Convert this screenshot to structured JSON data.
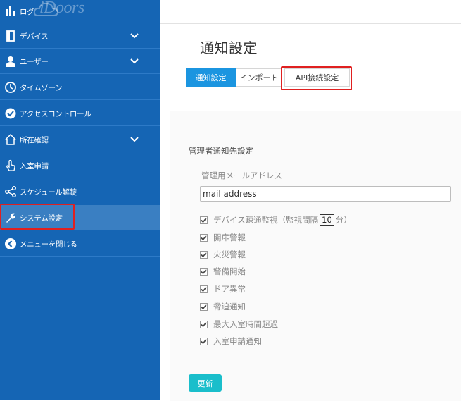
{
  "app": {
    "logo_text": "iDoors"
  },
  "sidebar": {
    "items": [
      {
        "label": "ログ",
        "icon": "bar-chart-icon"
      },
      {
        "label": "デバイス",
        "icon": "device-icon",
        "expandable": true
      },
      {
        "label": "ユーザー",
        "icon": "user-icon",
        "expandable": true
      },
      {
        "label": "タイムゾーン",
        "icon": "clock-icon"
      },
      {
        "label": "アクセスコントロール",
        "icon": "check-circle-icon"
      },
      {
        "label": "所在確認",
        "icon": "home-icon",
        "expandable": true
      },
      {
        "label": "入室申請",
        "icon": "hand-pointer-icon"
      },
      {
        "label": "スケジュール解錠",
        "icon": "share-icon"
      },
      {
        "label": "システム設定",
        "icon": "wrench-icon",
        "active": true
      },
      {
        "label": "メニューを閉じる",
        "icon": "chevron-left-circle-icon"
      }
    ]
  },
  "main": {
    "title": "通知設定",
    "tabs": [
      {
        "label": "通知設定",
        "active": true
      },
      {
        "label": "インポート",
        "active": false
      },
      {
        "label": "API接続設定",
        "active": false
      }
    ],
    "section_title": "管理者通知先設定",
    "email_label": "管理用メールアドレス",
    "email_placeholder": "mail address",
    "checkboxes": [
      {
        "label_before": "デバイス疎通監視（監視間隔",
        "value": "10",
        "label_after": "分）",
        "checked": true
      },
      {
        "label": "開扉警報",
        "checked": true
      },
      {
        "label": "火災警報",
        "checked": true
      },
      {
        "label": "警備開始",
        "checked": true
      },
      {
        "label": "ドア異常",
        "checked": true
      },
      {
        "label": "脅迫通知",
        "checked": true
      },
      {
        "label": "最大入室時間超過",
        "checked": true
      },
      {
        "label": "入室申請通知",
        "checked": true
      }
    ],
    "update_button": "更新"
  },
  "colors": {
    "sidebar": "#1565b4",
    "tab_active": "#1b95e0",
    "update_button": "#1abecb",
    "highlight": "#e02020"
  }
}
